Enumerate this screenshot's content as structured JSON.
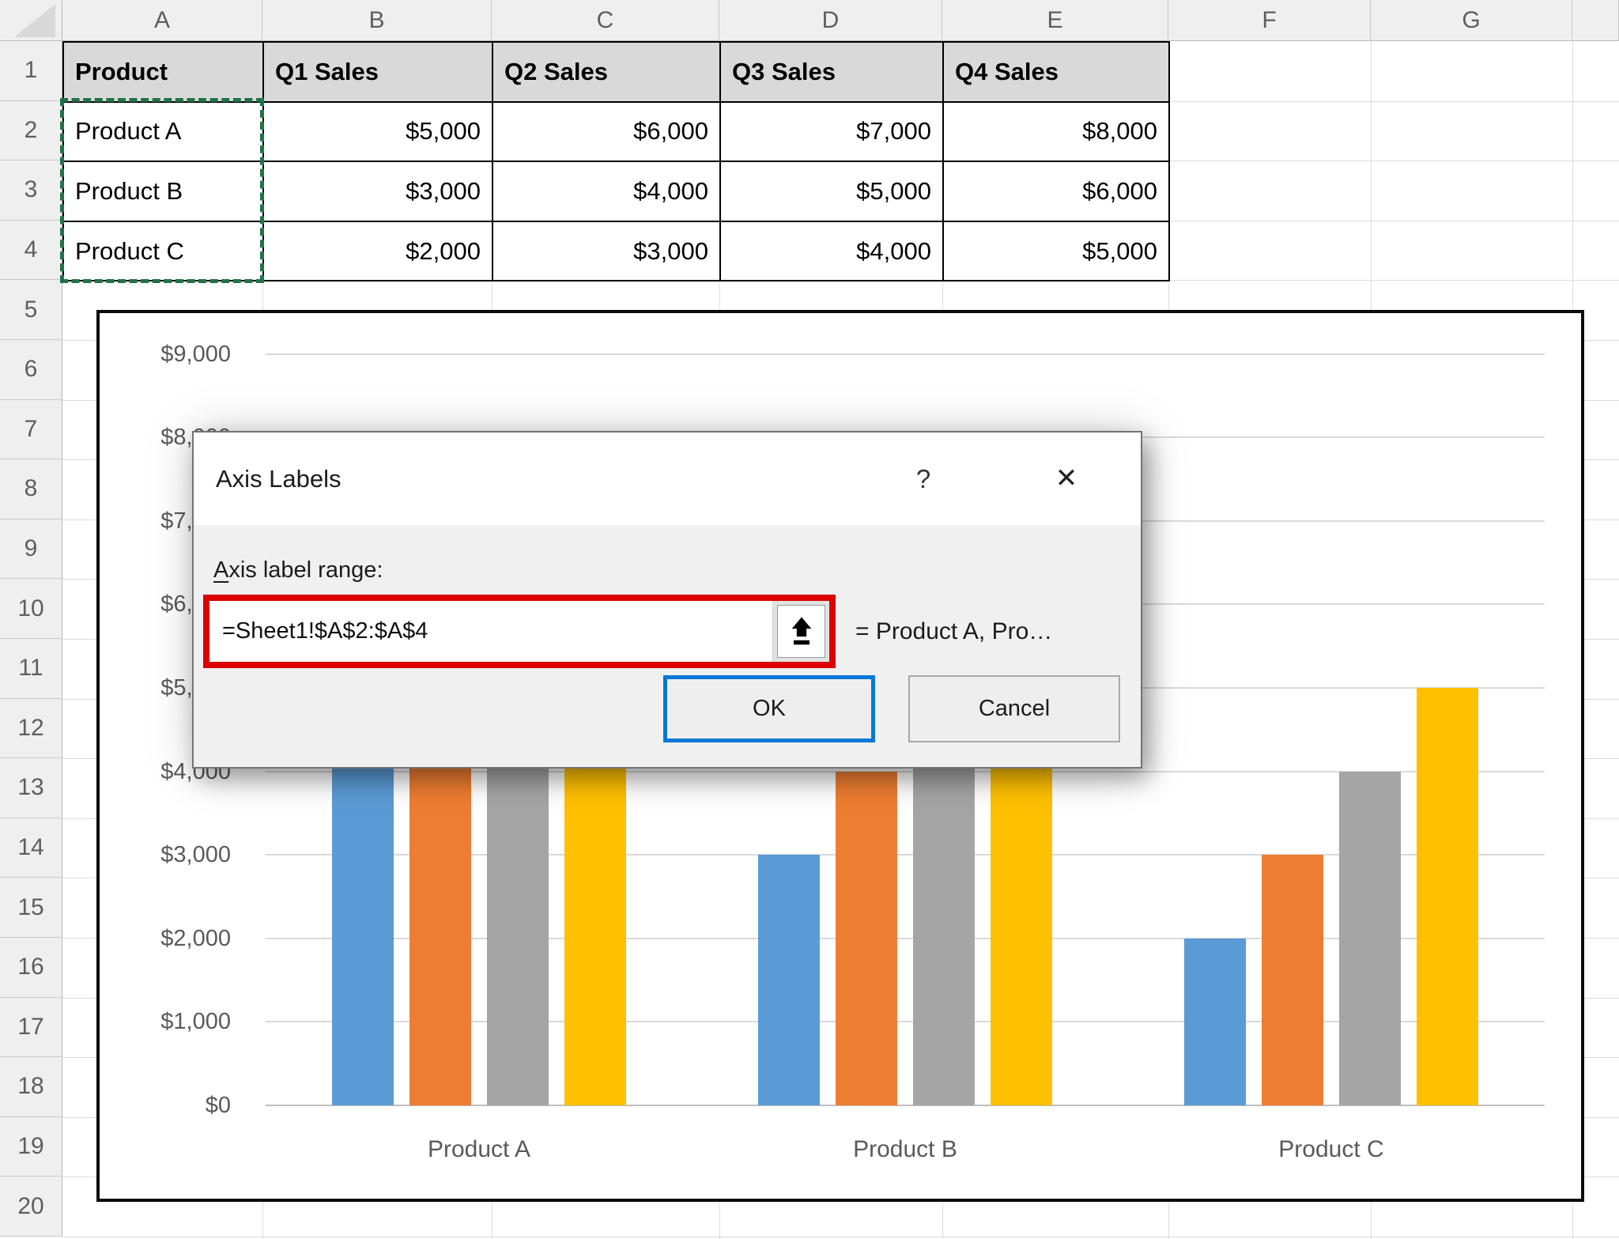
{
  "sheet": {
    "column_headers": [
      "A",
      "B",
      "C",
      "D",
      "E",
      "F",
      "G"
    ],
    "row_headers": [
      "1",
      "2",
      "3",
      "4",
      "5",
      "6",
      "7",
      "8",
      "9",
      "10",
      "11",
      "12",
      "13",
      "14",
      "15",
      "16",
      "17",
      "18",
      "19",
      "20"
    ],
    "table": {
      "headers": [
        "Product",
        "Q1 Sales",
        "Q2 Sales",
        "Q3 Sales",
        "Q4 Sales"
      ],
      "rows": [
        [
          "Product A",
          "$5,000",
          "$6,000",
          "$7,000",
          "$8,000"
        ],
        [
          "Product B",
          "$3,000",
          "$4,000",
          "$5,000",
          "$6,000"
        ],
        [
          "Product C",
          "$2,000",
          "$3,000",
          "$4,000",
          "$5,000"
        ]
      ]
    },
    "selection_range": "A2:A4"
  },
  "chart_data": {
    "type": "bar",
    "categories": [
      "Product A",
      "Product B",
      "Product C"
    ],
    "series": [
      {
        "name": "Q1 Sales",
        "color": "#5B9BD5",
        "values": [
          5000,
          3000,
          2000
        ]
      },
      {
        "name": "Q2 Sales",
        "color": "#ED7D31",
        "values": [
          6000,
          4000,
          3000
        ]
      },
      {
        "name": "Q3 Sales",
        "color": "#A5A5A5",
        "values": [
          7000,
          5000,
          4000
        ]
      },
      {
        "name": "Q4 Sales",
        "color": "#FFC000",
        "values": [
          8000,
          6000,
          5000
        ]
      }
    ],
    "title": "",
    "xlabel": "",
    "ylabel": "",
    "ylim": [
      0,
      9000
    ],
    "ytick_step": 1000,
    "ytick_labels": [
      "$0",
      "$1,000",
      "$2,000",
      "$3,000",
      "$4,000",
      "$5,000",
      "$6,000",
      "$7,000",
      "$8,000",
      "$9,000"
    ],
    "grid": true,
    "legend": "none"
  },
  "dialog": {
    "title": "Axis Labels",
    "help_label": "?",
    "close_label": "✕",
    "field_label_prefix": "A",
    "field_label_rest": "xis label range:",
    "field_value": "=Sheet1!$A$2:$A$4",
    "preview": "= Product A, Pro…",
    "ok_label": "OK",
    "cancel_label": "Cancel"
  },
  "colors": {
    "annotation_red": "#DC0000",
    "focus_blue": "#0078D7",
    "selection_green": "#217346",
    "table_header_fill": "#D9D9D9",
    "axis_text": "#595959",
    "gridline": "#D9D9D9"
  }
}
